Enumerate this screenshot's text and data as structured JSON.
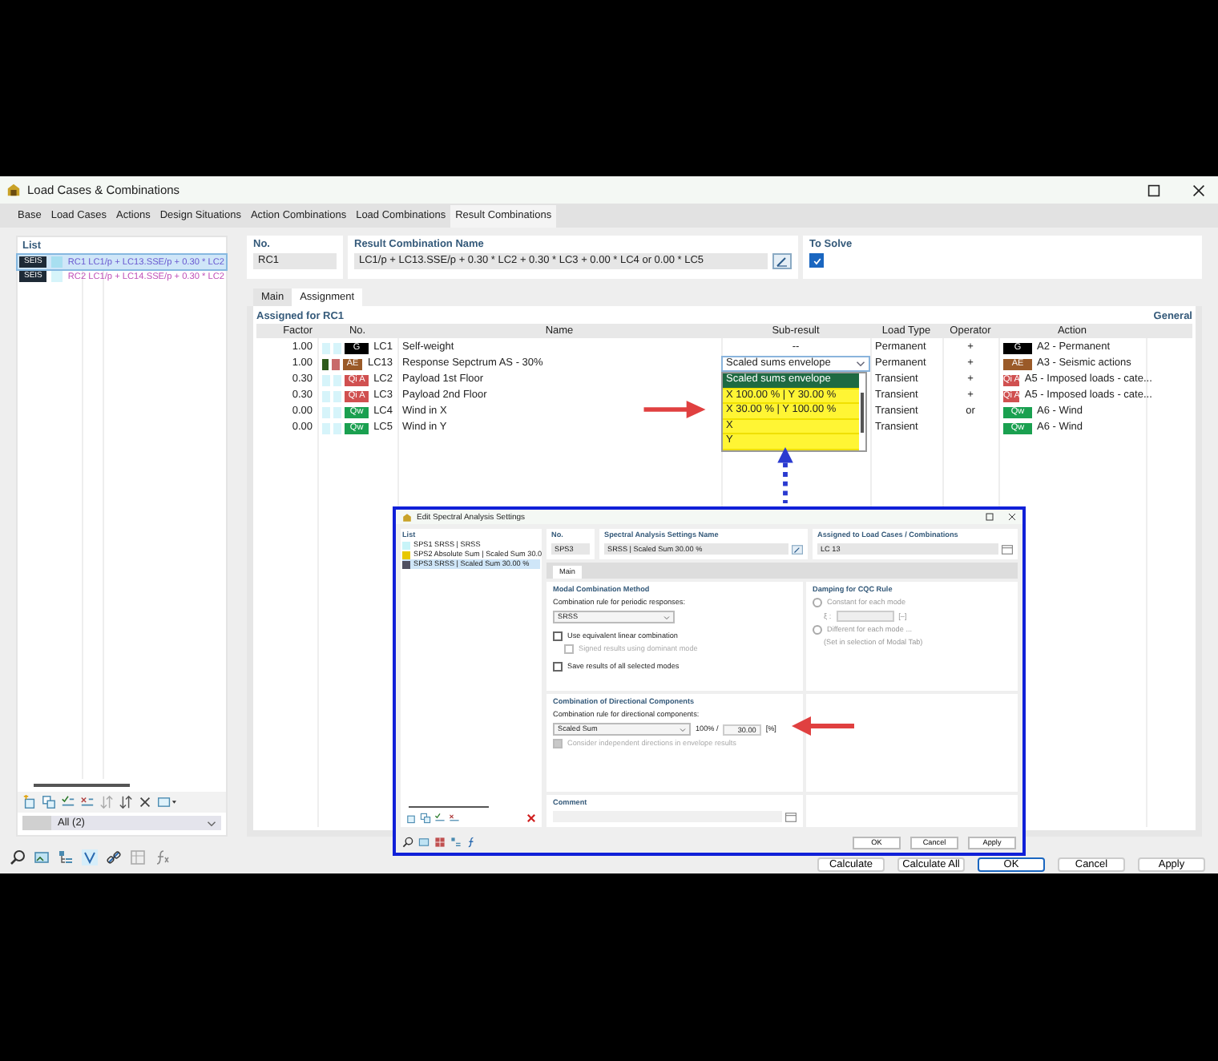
{
  "window": {
    "title": "Load Cases & Combinations"
  },
  "tabs": [
    {
      "label": "Base",
      "selected": false
    },
    {
      "label": "Load Cases",
      "selected": false
    },
    {
      "label": "Actions",
      "selected": false
    },
    {
      "label": "Design Situations",
      "selected": false
    },
    {
      "label": "Action Combinations",
      "selected": false
    },
    {
      "label": "Load Combinations",
      "selected": false
    },
    {
      "label": "Result Combinations",
      "selected": true
    }
  ],
  "list": {
    "title": "List",
    "items": [
      {
        "tag": "SEIS",
        "color": "#a8dff0",
        "label": "RC1 LC1/p + LC13.SSE/p + 0.30 * LC2",
        "selected": true
      },
      {
        "tag": "SEIS",
        "color": "#d6f4fa",
        "label": "RC2 LC1/p + LC14.SSE/p + 0.30 * LC2",
        "selected": false
      }
    ],
    "filter": "All (2)"
  },
  "number": {
    "label": "No.",
    "value": "RC1"
  },
  "combination_name": {
    "label": "Result Combination Name",
    "value": "LC1/p + LC13.SSE/p + 0.30 * LC2 + 0.30 * LC3 + 0.00 * LC4 or 0.00 * LC5"
  },
  "to_solve": {
    "label": "To Solve",
    "checked": true
  },
  "inner_tabs": [
    {
      "label": "Main",
      "selected": false
    },
    {
      "label": "Assignment",
      "selected": true
    }
  ],
  "assigned": {
    "title": "Assigned for RC1",
    "link": "General",
    "columns": [
      "Factor",
      "No.",
      "Name",
      "Sub-result",
      "Load Type",
      "Operator",
      "Action"
    ],
    "rows": [
      {
        "factor": "1.00",
        "flags": [
          {
            "color": "#d6f4fa"
          },
          {
            "color": "#d6f4fa"
          }
        ],
        "tag": {
          "text": "G",
          "color": "#000000"
        },
        "no": "LC1",
        "name": "Self-weight",
        "sub_result": {
          "kind": "text",
          "value": "--"
        },
        "load_type": "Permanent",
        "operator": "+",
        "action_tag": {
          "text": "G",
          "color": "#000000"
        },
        "action": "A2 - Permanent"
      },
      {
        "factor": "1.00",
        "flags": [
          {
            "color": "#2e5a1c"
          },
          {
            "color": "#c86a6a"
          }
        ],
        "tag": {
          "text": "AE",
          "color": "#9a5a28"
        },
        "no": "LC13",
        "name": "Response Sepctrum AS - 30%",
        "sub_result": {
          "kind": "dropdown",
          "value": "Scaled sums envelope",
          "open": true,
          "options": [
            {
              "label": "Scaled sums envelope",
              "selected": true
            },
            {
              "label": "X 100.00 % | Y 30.00 %",
              "selected": false
            },
            {
              "label": "X 30.00 % | Y 100.00 %",
              "selected": false
            },
            {
              "label": "X",
              "selected": false
            },
            {
              "label": "Y",
              "selected": false
            }
          ]
        },
        "load_type": "Permanent",
        "operator": "+",
        "action_tag": {
          "text": "AE",
          "color": "#9a5a28"
        },
        "action": "A3 - Seismic actions"
      },
      {
        "factor": "0.30",
        "flags": [
          {
            "color": "#d6f4fa"
          },
          {
            "color": "#d6f4fa"
          }
        ],
        "tag": {
          "text": "Qi A",
          "color": "#d05050"
        },
        "no": "LC2",
        "name": "Payload 1st Floor",
        "load_type": "Transient",
        "operator": "+",
        "action_tag": {
          "text": "Qi A",
          "color": "#d05050"
        },
        "action": "A5 - Imposed loads - cate..."
      },
      {
        "factor": "0.30",
        "flags": [
          {
            "color": "#d6f4fa"
          },
          {
            "color": "#d6f4fa"
          }
        ],
        "tag": {
          "text": "Qi A",
          "color": "#d05050"
        },
        "no": "LC3",
        "name": "Payload 2nd Floor",
        "load_type": "Transient",
        "operator": "+",
        "action_tag": {
          "text": "Qi A",
          "color": "#d05050"
        },
        "action": "A5 - Imposed loads - cate..."
      },
      {
        "factor": "0.00",
        "flags": [
          {
            "color": "#d6f4fa"
          },
          {
            "color": "#d6f4fa"
          }
        ],
        "tag": {
          "text": "Qw",
          "color": "#1aa050"
        },
        "no": "LC4",
        "name": "Wind in X",
        "load_type": "Transient",
        "operator": "or",
        "action_tag": {
          "text": "Qw",
          "color": "#1aa050"
        },
        "action": "A6 - Wind"
      },
      {
        "factor": "0.00",
        "flags": [
          {
            "color": "#d6f4fa"
          },
          {
            "color": "#d6f4fa"
          }
        ],
        "tag": {
          "text": "Qw",
          "color": "#1aa050"
        },
        "no": "LC5",
        "name": "Wind in Y",
        "load_type": "Transient",
        "operator": "",
        "action_tag": {
          "text": "Qw",
          "color": "#1aa050"
        },
        "action": "A6 - Wind"
      }
    ]
  },
  "footer_buttons": [
    {
      "label": "Calculate",
      "default": false
    },
    {
      "label": "Calculate All",
      "default": false
    },
    {
      "label": "OK",
      "default": true
    },
    {
      "label": "Cancel",
      "default": false
    },
    {
      "label": "Apply",
      "default": false
    }
  ],
  "dialog": {
    "title": "Edit Spectral Analysis Settings",
    "list": {
      "title": "List",
      "items": [
        {
          "label": "SPS1 SRSS | SRSS",
          "color": "#c8f4f8",
          "selected": false
        },
        {
          "label": "SPS2 Absolute Sum | Scaled Sum 30.0",
          "color": "#e8c800",
          "selected": false
        },
        {
          "label": "SPS3 SRSS | Scaled Sum 30.00 %",
          "color": "#505060",
          "selected": true
        }
      ]
    },
    "number": {
      "label": "No.",
      "value": "SPS3"
    },
    "name": {
      "label": "Spectral Analysis Settings Name",
      "value": "SRSS | Scaled Sum 30.00 %"
    },
    "assigned": {
      "label": "Assigned to Load Cases / Combinations",
      "value": "LC 13"
    },
    "tabs": [
      {
        "label": "Main",
        "selected": true
      }
    ],
    "modal": {
      "title": "Modal Combination Method",
      "rule_label": "Combination rule for periodic responses:",
      "rule": "SRSS",
      "options": [
        {
          "label": "Use equivalent linear combination",
          "checked": false,
          "disabled": false
        },
        {
          "label": "Signed results using dominant mode",
          "checked": false,
          "disabled": true
        },
        {
          "label": "Save results of all selected modes",
          "checked": false,
          "disabled": false
        }
      ]
    },
    "damping": {
      "title": "Damping for CQC Rule",
      "disabled": true,
      "options": [
        {
          "label": "Constant for each mode",
          "selected": false
        },
        {
          "label": "Different for each mode ...",
          "selected": false
        }
      ],
      "xi_label": "ξ :",
      "xi_unit": "[–]",
      "note": "(Set in selection of Modal Tab)"
    },
    "directional": {
      "title": "Combination of Directional Components",
      "rule_label": "Combination rule for directional components:",
      "rule": "Scaled Sum",
      "prefix": "100% /",
      "value": "30.00",
      "unit": "[%]",
      "option": {
        "label": "Consider independent directions in envelope results",
        "checked": true,
        "disabled": true
      }
    },
    "comment": {
      "label": "Comment"
    },
    "buttons": [
      "OK",
      "Cancel",
      "Apply"
    ]
  }
}
